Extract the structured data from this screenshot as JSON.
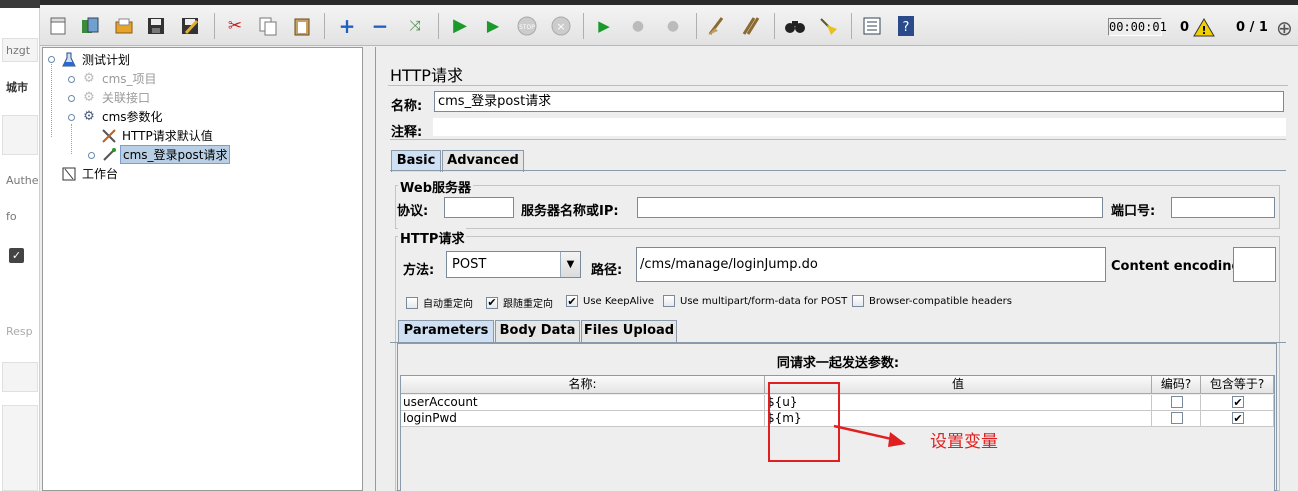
{
  "background_app": {
    "texts": [
      "hzgt",
      "城市",
      "Authe",
      "fo",
      "Resp"
    ]
  },
  "toolbar": {
    "icons": [
      "new-icon",
      "templates-icon",
      "open-icon",
      "save-icon",
      "save-as-icon",
      "cut-icon",
      "copy-icon",
      "paste-icon",
      "expand-icon",
      "collapse-icon",
      "toggle-icon",
      "start-icon",
      "start-no-pause-icon",
      "stop-icon",
      "shutdown-icon",
      "remote-start-icon",
      "remote-stop-icon",
      "remote-shutdown-icon",
      "clear-icon",
      "clear-all-icon",
      "search-icon",
      "reset-search-icon",
      "function-helper-icon",
      "help-icon"
    ],
    "timer": "00:00:01",
    "error_count": "0",
    "threads": "0 / 1"
  },
  "tree": {
    "nodes": [
      {
        "label": "测试计划",
        "icon": "test-plan-icon",
        "level": 0,
        "state": "normal"
      },
      {
        "label": "cms_项目",
        "icon": "gear-icon",
        "level": 1,
        "state": "disabled"
      },
      {
        "label": "关联接口",
        "icon": "gear-icon",
        "level": 1,
        "state": "disabled"
      },
      {
        "label": "cms参数化",
        "icon": "gear-icon",
        "level": 1,
        "state": "normal"
      },
      {
        "label": "HTTP请求默认值",
        "icon": "tools-icon",
        "level": 2,
        "state": "normal"
      },
      {
        "label": "cms_登录post请求",
        "icon": "pipette-icon",
        "level": 2,
        "state": "selected"
      },
      {
        "label": "工作台",
        "icon": "workbench-icon",
        "level": 0,
        "state": "normal"
      }
    ]
  },
  "panel": {
    "title": "HTTP请求",
    "name_label": "名称:",
    "name_value": "cms_登录post请求",
    "comment_label": "注释:",
    "tabs": [
      "Basic",
      "Advanced"
    ],
    "web_server": {
      "title": "Web服务器",
      "protocol_label": "协议:",
      "server_label": "服务器名称或IP:",
      "port_label": "端口号:",
      "protocol_value": "",
      "server_value": "",
      "port_value": ""
    },
    "http_request": {
      "title": "HTTP请求",
      "method_label": "方法:",
      "method_value": "POST",
      "path_label": "路径:",
      "path_value": "/cms/manage/loginJump.do",
      "encoding_label": "Content encoding:",
      "encoding_value": ""
    },
    "options": [
      {
        "label": "自动重定向",
        "checked": false
      },
      {
        "label": "跟随重定向",
        "checked": true
      },
      {
        "label": "Use KeepAlive",
        "checked": true
      },
      {
        "label": "Use multipart/form-data for POST",
        "checked": false
      },
      {
        "label": "Browser-compatible headers",
        "checked": false
      }
    ],
    "param_tabs": [
      "Parameters",
      "Body Data",
      "Files Upload"
    ],
    "params_title": "同请求一起发送参数:",
    "columns": [
      "名称:",
      "值",
      "编码?",
      "包含等于?"
    ],
    "rows": [
      {
        "name": "userAccount",
        "value": "${u}",
        "encode": false,
        "include_equals": true
      },
      {
        "name": "loginPwd",
        "value": "${m}",
        "encode": false,
        "include_equals": true
      }
    ]
  },
  "annotation": {
    "text": "设置变量",
    "color": "#e02020"
  }
}
